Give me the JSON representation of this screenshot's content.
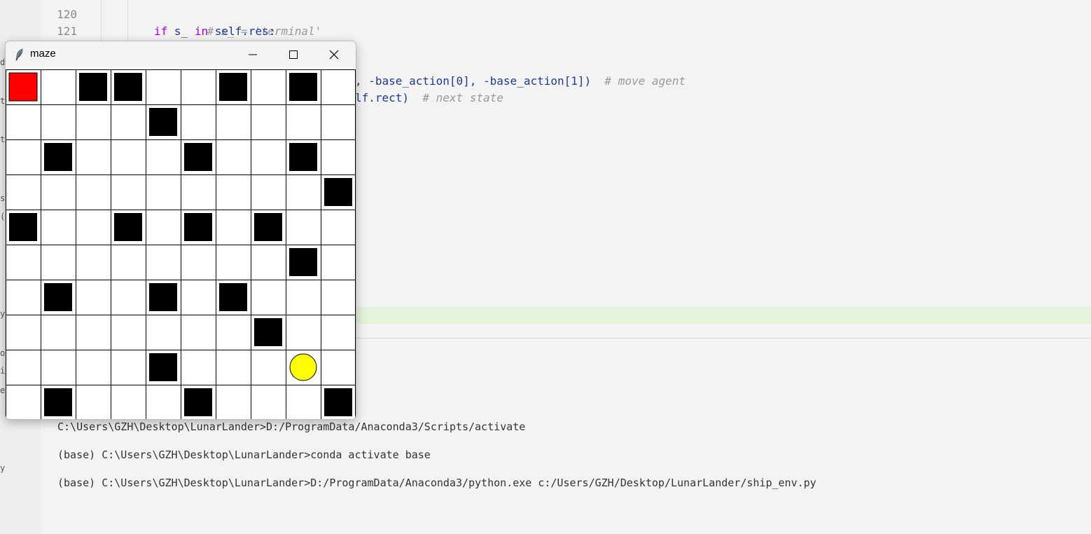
{
  "editor": {
    "line_numbers": [
      "120",
      "121"
    ],
    "code": {
      "l120": "# s_ = 'terminal'",
      "l121_kw": "if",
      "l121_a": "s_",
      "l121_in": "in",
      "l121_b": "self.res:",
      "move_pre": ", ",
      "move_call": "-base_action[0], -base_action[1])",
      "move_comment": "# move agent",
      "next_pre": "lf.rect)",
      "next_comment": "# next state"
    }
  },
  "left_strip_chars": [
    "d",
    "ti",
    "t",
    "s",
    "(",
    "y",
    "o",
    "ij",
    "e",
    "y"
  ],
  "terminal": {
    "lines": [
      "C:\\Users\\GZH\\Desktop\\LunarLander>D:/ProgramData/Anaconda3/Scripts/activate",
      "(base) C:\\Users\\GZH\\Desktop\\LunarLander>conda activate base",
      "(base) C:\\Users\\GZH\\Desktop\\LunarLander>D:/ProgramData/Anaconda3/python.exe c:/Users/GZH/Desktop/LunarLander/ship_env.py"
    ]
  },
  "maze_window": {
    "title": "maze",
    "rows": 10,
    "cols": 10,
    "agent": {
      "row": 0,
      "col": 0,
      "color": "#ff0000"
    },
    "goal": {
      "row": 8,
      "col": 8,
      "color": "#ffff00"
    },
    "wall_color": "#000000",
    "walls": [
      [
        0,
        2
      ],
      [
        0,
        3
      ],
      [
        0,
        6
      ],
      [
        0,
        8
      ],
      [
        1,
        4
      ],
      [
        2,
        1
      ],
      [
        2,
        5
      ],
      [
        2,
        8
      ],
      [
        3,
        9
      ],
      [
        4,
        0
      ],
      [
        4,
        3
      ],
      [
        4,
        5
      ],
      [
        4,
        7
      ],
      [
        5,
        8
      ],
      [
        6,
        1
      ],
      [
        6,
        4
      ],
      [
        6,
        6
      ],
      [
        7,
        7
      ],
      [
        8,
        4
      ],
      [
        9,
        1
      ],
      [
        9,
        5
      ],
      [
        9,
        9
      ]
    ]
  }
}
